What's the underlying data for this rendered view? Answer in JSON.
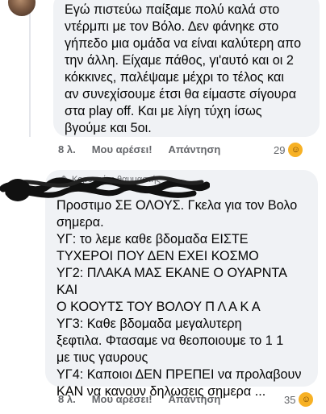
{
  "comment1": {
    "text": "Εγώ πιστεύω παίξαμε πολύ καλά στο\nντέρμπι με τον Βόλο. Δεν φάνηκε στο\nγήπεδο μια ομάδα να είναι καλύτερη απο\nτην άλλη. Είχαμε πάθος, γι'αυτό και οι 2\nκόκκινες, παλέψαμε μέχρι το τέλος και\nαν συνεχίσουμε έτσι θα είμαστε σίγουρα\nστα play off. Και με λίγη τύχη ίσως\nβγούμε και 5οι.",
    "time": "8 λ.",
    "like_label": "Μου αρέσει!",
    "reply_label": "Απάντηση",
    "reaction_count": "29"
  },
  "comment2": {
    "badge": "Κορυφαίος θαυμαστής",
    "text": "Προστιμο ΣΕ ΟΛΟΥΣ. Γκελα για τον Βολο\nσημερα.\nΥΓ: το λεμε καθε βδομαδα ΕΙΣΤΕ\nΤΥΧΕΡΟΙ ΠΟΥ ΔΕΝ ΕΧΕΙ ΚΟΣΜΟ\nΥΓ2: ΠΛΑΚΑ ΜΑΣ ΕΚΑΝΕ Ο ΟΥΑΡΝΤΑ ΚΑΙ\nΟ ΚΟΟΥΤΣ ΤΟΥ ΒΟΛΟΥ Π Λ Α Κ Α\nΥΓ3: Καθε βδομαδα μεγαλυτερη\nξεφτιλα. Φτασαμε να θεοποιουμε το 1 1\nμε τιυς γαυρους\nΥΓ4: Καποιοι ΔΕΝ ΠΡΕΠΕΙ να προλαβουν\nΚΑΝ να κανουν δηλωσεις σημερα ...",
    "time": "8 λ.",
    "like_label": "Μου αρέσει!",
    "reply_label": "Απάντηση",
    "reaction_count": "35"
  },
  "colors": {
    "bubble": "#f0f2f5",
    "meta": "#65676b",
    "text": "#050505",
    "reaction": "#f7b125"
  },
  "icons": {
    "reaction1": "haha-emoji-icon",
    "reaction2": "haha-emoji-icon",
    "badge": "top-fan-badge-icon"
  }
}
